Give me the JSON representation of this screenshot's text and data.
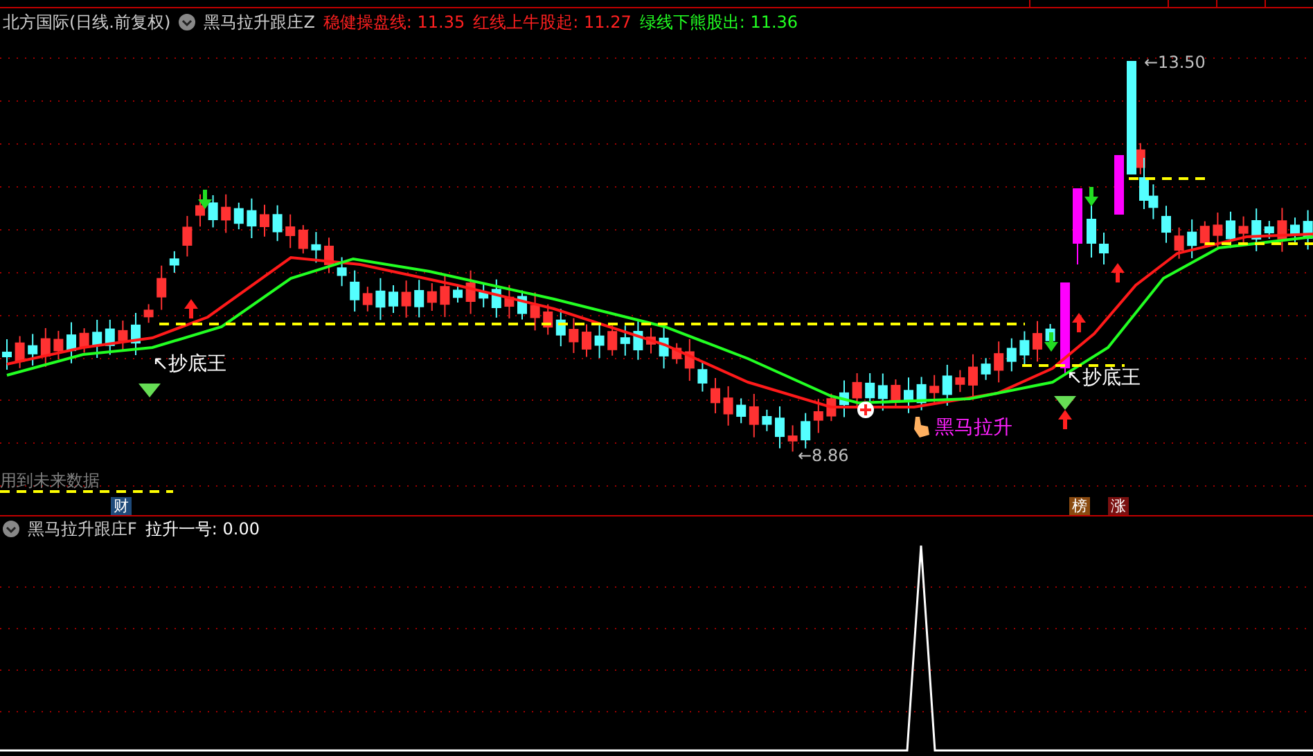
{
  "header": {
    "stock": "北方国际(日线.前复权)",
    "indicator": "黑马拉升跟庄Z",
    "values": [
      {
        "text": "稳健操盘线: 11.35",
        "color": "#ff2020"
      },
      {
        "text": "红线上牛股起: 11.27",
        "color": "#ff2020"
      },
      {
        "text": "绿线下熊股出: 11.36",
        "color": "#22ff22"
      }
    ]
  },
  "chart_labels": [
    {
      "text": "↖抄底王",
      "color": "#ffffff"
    },
    {
      "text": "←8.86",
      "color": "#c0c0c0"
    },
    {
      "text": "←13.50",
      "color": "#c0c0c0"
    },
    {
      "text": "黑马拉升",
      "color": "#ff20ff"
    },
    {
      "text": "↖抄底王",
      "color": "#ffffff"
    },
    {
      "text": "用到未来数据",
      "color": "#808080"
    }
  ],
  "badges": [
    {
      "text": "财",
      "color": "#1e4a7a"
    },
    {
      "text": "榜",
      "color": "#8a4a10"
    },
    {
      "text": "涨",
      "color": "#7a1010"
    }
  ],
  "lower_panel": {
    "indicator": "黑马拉升跟庄F",
    "value": "拉升一号: 0.00"
  }
}
